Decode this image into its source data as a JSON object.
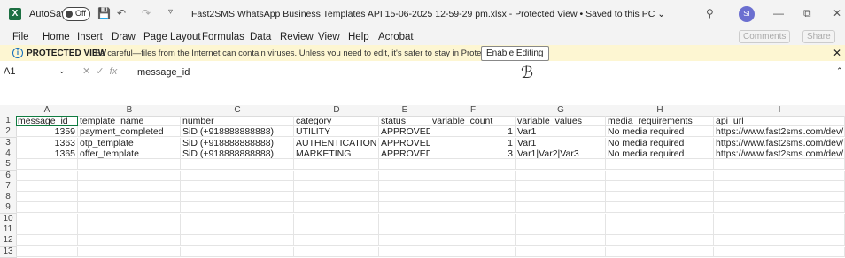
{
  "titlebar": {
    "app_icon": "X",
    "autosave_label": "AutoSave",
    "toggle_state": "Off",
    "title": "Fast2SMS WhatsApp Business Templates API 15-06-2025 12-59-29 pm.xlsx  -  Protected View  •  Saved to this PC ⌄",
    "user_initials": "SI"
  },
  "menu": [
    "File",
    "Home",
    "Insert",
    "Draw",
    "Page Layout",
    "Formulas",
    "Data",
    "Review",
    "View",
    "Help",
    "Acrobat"
  ],
  "ribbon_right": {
    "comments": "Comments",
    "share": "Share"
  },
  "protected": {
    "title": "PROTECTED VIEW",
    "message": "Be careful—files from the Internet can contain viruses. Unless you need to edit, it's safer to stay in Protected View.",
    "button": "Enable Editing"
  },
  "formula": {
    "namebox": "A1",
    "content": "message_id",
    "fx": "fx"
  },
  "columns": [
    "A",
    "B",
    "C",
    "D",
    "E",
    "F",
    "G",
    "H",
    "I"
  ],
  "rows": [
    "1",
    "2",
    "3",
    "4",
    "5",
    "6",
    "7",
    "8",
    "9",
    "10",
    "11",
    "12",
    "13"
  ],
  "table": [
    [
      "message_id",
      "template_name",
      "number",
      "category",
      "status",
      "variable_count",
      "variable_values",
      "media_requirements",
      "api_url"
    ],
    [
      "1359",
      "payment_completed",
      "SiD (+918888888888)",
      "UTILITY",
      "APPROVED",
      "1",
      "Var1",
      "No media required",
      "https://www.fast2sms.com/dev/"
    ],
    [
      "1363",
      "otp_template",
      "SiD (+918888888888)",
      "AUTHENTICATION",
      "APPROVED",
      "1",
      "Var1",
      "No media required",
      "https://www.fast2sms.com/dev/"
    ],
    [
      "1365",
      "offer_template",
      "SiD (+918888888888)",
      "MARKETING",
      "APPROVED",
      "3",
      "Var1|Var2|Var3",
      "No media required",
      "https://www.fast2sms.com/dev/"
    ]
  ]
}
